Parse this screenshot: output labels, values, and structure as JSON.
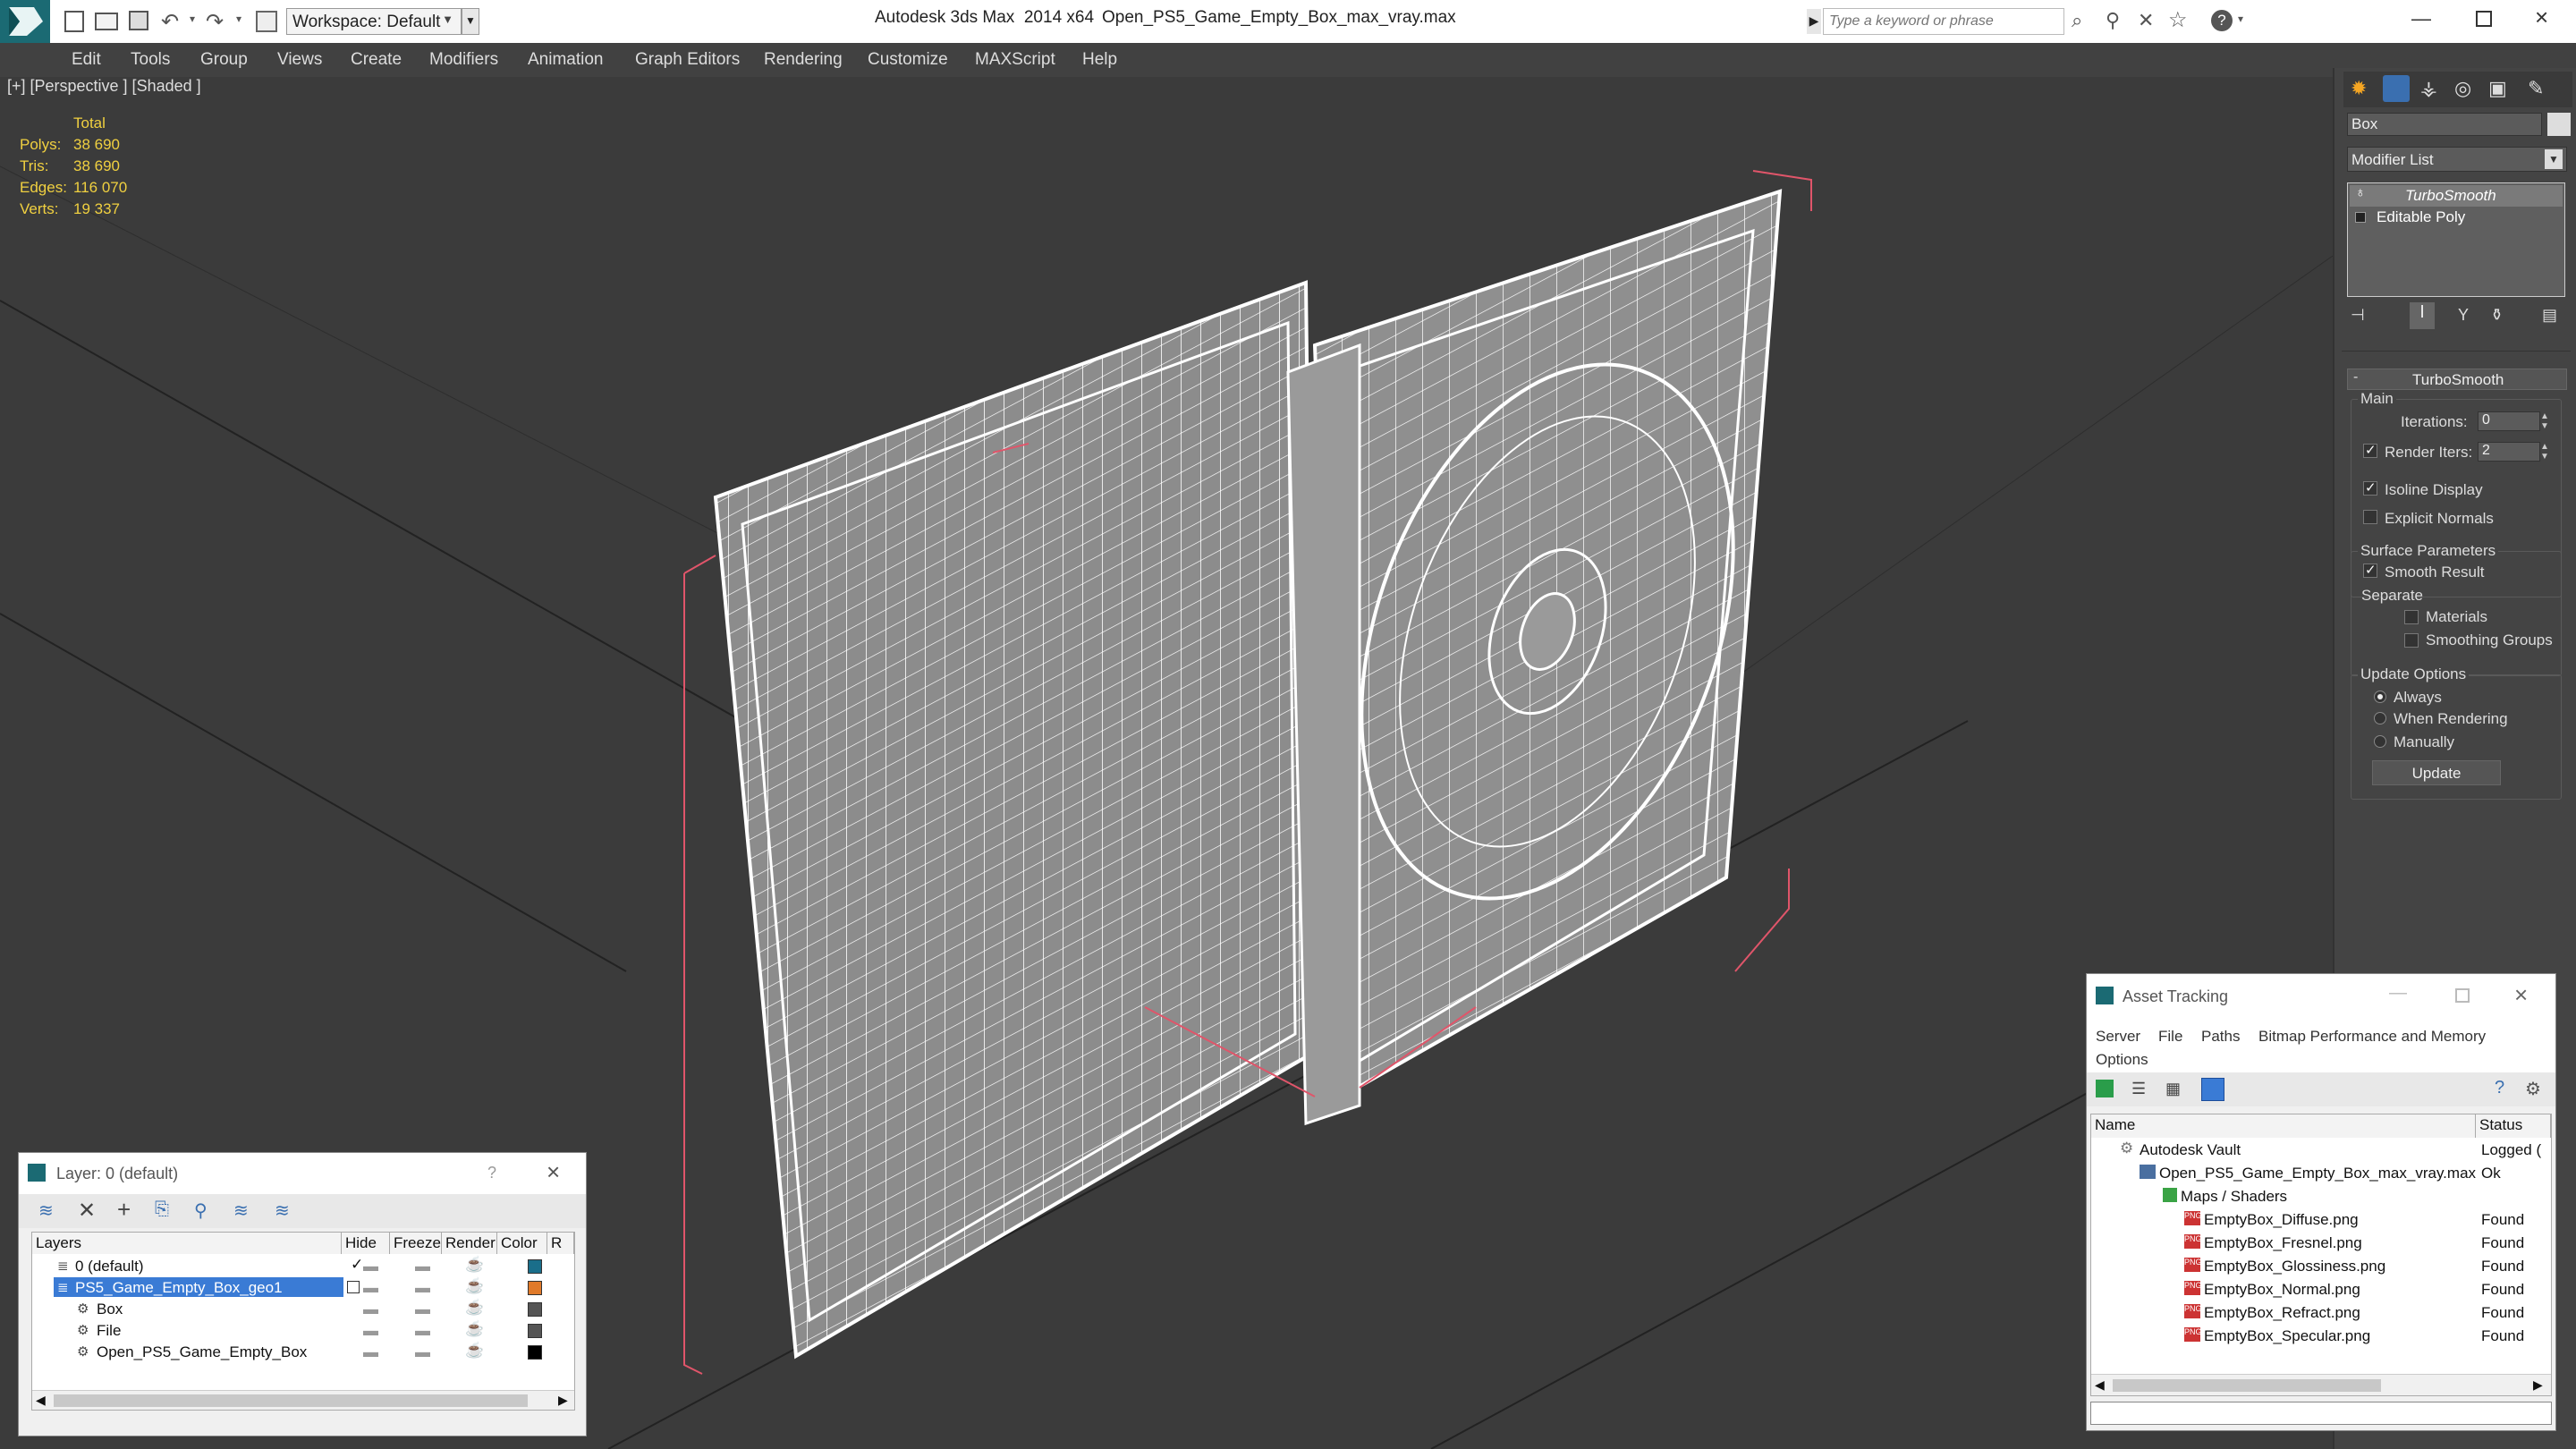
{
  "titlebar": {
    "workspace_label": "Workspace: Default",
    "app_title": "Autodesk 3ds Max  2014 x64",
    "file_title": "Open_PS5_Game_Empty_Box_max_vray.max",
    "search_placeholder": "Type a keyword or phrase"
  },
  "menu": [
    "Edit",
    "Tools",
    "Group",
    "Views",
    "Create",
    "Modifiers",
    "Animation",
    "Graph Editors",
    "Rendering",
    "Customize",
    "MAXScript",
    "Help"
  ],
  "viewport": {
    "label": "[+] [Perspective ] [Shaded ]",
    "stats_header": "Total",
    "stats": [
      {
        "label": "Polys:",
        "value": "38 690"
      },
      {
        "label": "Tris:",
        "value": "38 690"
      },
      {
        "label": "Edges:",
        "value": "116 070"
      },
      {
        "label": "Verts:",
        "value": "19 337"
      }
    ]
  },
  "command_panel": {
    "object_name": "Box",
    "modifier_list": "Modifier List",
    "stack": [
      "TurboSmooth",
      "Editable Poly"
    ],
    "rollout_title": "TurboSmooth",
    "main_group": "Main",
    "iterations_label": "Iterations:",
    "iterations_value": "0",
    "render_iters_label": "Render Iters:",
    "render_iters_value": "2",
    "isoline_label": "Isoline Display",
    "explicit_normals_label": "Explicit Normals",
    "surface_group": "Surface Parameters",
    "smooth_result_label": "Smooth Result",
    "separate_label": "Separate",
    "materials_label": "Materials",
    "smoothing_groups_label": "Smoothing Groups",
    "update_group": "Update Options",
    "always_label": "Always",
    "when_rendering_label": "When Rendering",
    "manually_label": "Manually",
    "update_button": "Update"
  },
  "layer_dialog": {
    "title": "Layer: 0 (default)",
    "help": "?",
    "columns": [
      "Layers",
      "Hide",
      "Freeze",
      "Render",
      "Color",
      "R"
    ],
    "rows": [
      {
        "name": "0 (default)",
        "indent": 0,
        "selected": false,
        "color": "#1a6e8a"
      },
      {
        "name": "PS5_Game_Empty_Box_geo1",
        "indent": 0,
        "selected": true,
        "color": "#e07a2a"
      },
      {
        "name": "Box",
        "indent": 1,
        "selected": false,
        "color": "#555555"
      },
      {
        "name": "File",
        "indent": 1,
        "selected": false,
        "color": "#555555"
      },
      {
        "name": "Open_PS5_Game_Empty_Box",
        "indent": 1,
        "selected": false,
        "color": "#000000"
      }
    ]
  },
  "asset_dialog": {
    "title": "Asset Tracking",
    "menu": [
      "Server",
      "File",
      "Paths",
      "Bitmap Performance and Memory",
      "Options"
    ],
    "columns": [
      "Name",
      "Status"
    ],
    "rows": [
      {
        "name": "Autodesk Vault",
        "status": "Logged (",
        "indent": 0
      },
      {
        "name": "Open_PS5_Game_Empty_Box_max_vray.max",
        "status": "Ok",
        "indent": 1
      },
      {
        "name": "Maps / Shaders",
        "status": "",
        "indent": 2
      },
      {
        "name": "EmptyBox_Diffuse.png",
        "status": "Found",
        "indent": 3
      },
      {
        "name": "EmptyBox_Fresnel.png",
        "status": "Found",
        "indent": 3
      },
      {
        "name": "EmptyBox_Glossiness.png",
        "status": "Found",
        "indent": 3
      },
      {
        "name": "EmptyBox_Normal.png",
        "status": "Found",
        "indent": 3
      },
      {
        "name": "EmptyBox_Refract.png",
        "status": "Found",
        "indent": 3
      },
      {
        "name": "EmptyBox_Specular.png",
        "status": "Found",
        "indent": 3
      }
    ]
  }
}
